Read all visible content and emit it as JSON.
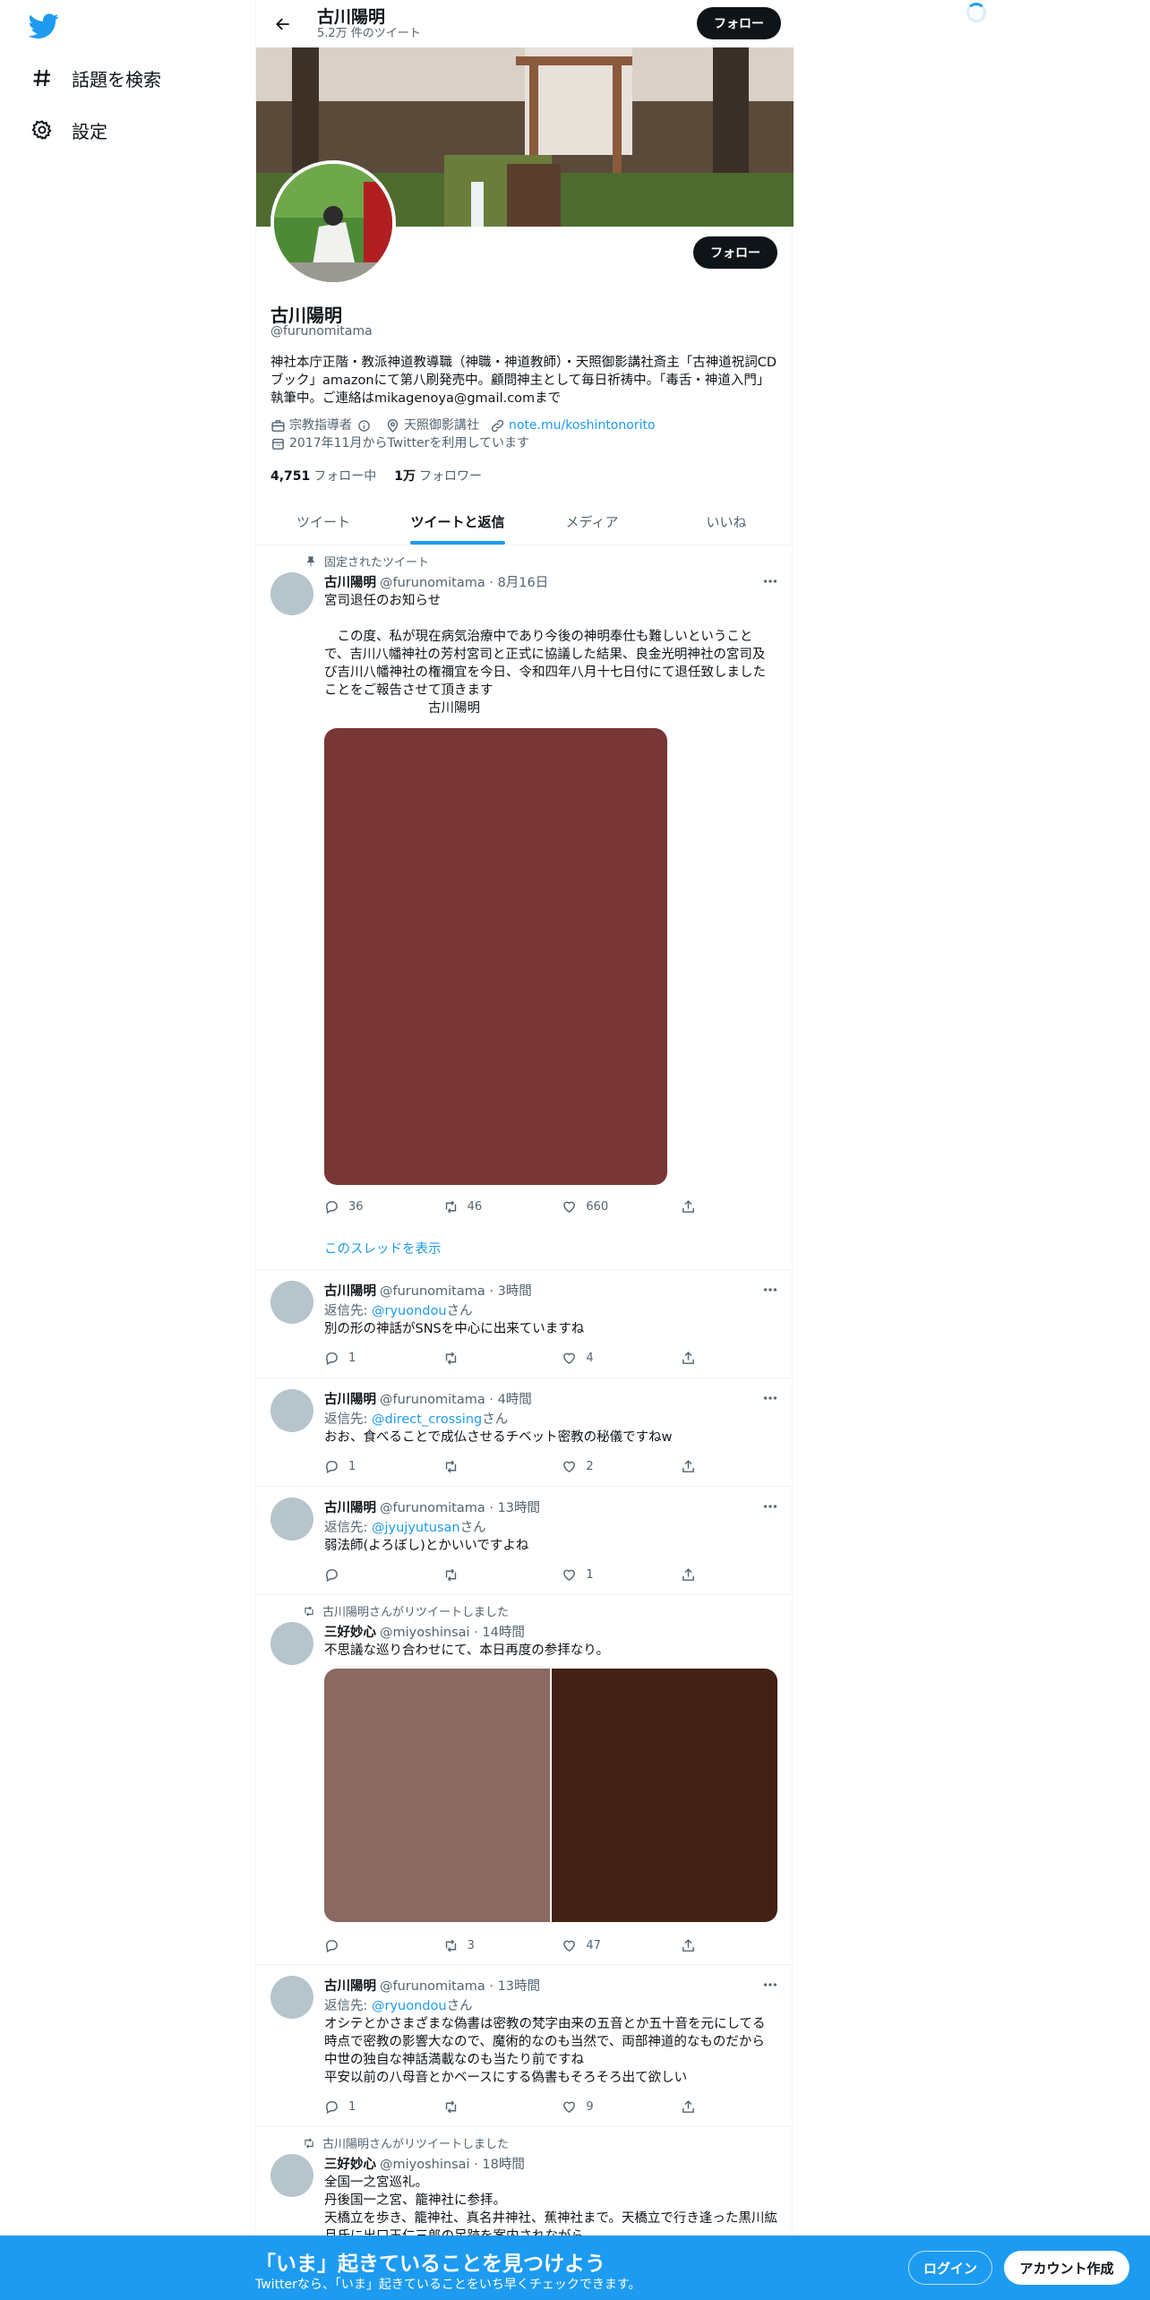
{
  "sidebar": {
    "items": [
      {
        "label": "話題を検索",
        "icon": "hashtag-icon"
      },
      {
        "label": "設定",
        "icon": "gear-icon"
      }
    ]
  },
  "header": {
    "name": "古川陽明",
    "tweet_count": "5.2万 件のツイート",
    "follow_label": "フォロー"
  },
  "profile": {
    "name": "古川陽明",
    "handle": "@furunomitama",
    "bio": "神社本庁正階・教派神道教導職（神職・神道教師）・天照御影講社斎主「古神道祝詞CDブック」amazonにて第八刷発売中。顧問神主として毎日祈祷中。「毒舌・神道入門」執筆中。ご連絡はmikagenoya@gmail.comまで",
    "category": "宗教指導者",
    "location": "天照御影講社",
    "website": "note.mu/koshintonorito",
    "joined": "2017年11月からTwitterを利用しています",
    "following_count": "4,751",
    "following_label": "フォロー中",
    "followers_count": "1万",
    "followers_label": "フォロワー",
    "follow_label": "フォロー"
  },
  "tabs": [
    {
      "label": "ツイート",
      "active": false
    },
    {
      "label": "ツイートと返信",
      "active": true
    },
    {
      "label": "メディア",
      "active": false
    },
    {
      "label": "いいね",
      "active": false
    }
  ],
  "tweets": [
    {
      "context": "固定されたツイート",
      "name": "古川陽明",
      "handle_time": "@furunomitama · 8月16日",
      "text": "宮司退任のお知らせ\n\n　この度、私が現在病気治療中であり今後の神明奉仕も難しいということで、吉川八幡神社の芳村宮司と正式に協議した結果、良金光明神社の宮司及び吉川八幡神社の権禰宜を今日、令和四年八月十七日付にて退任致しましたことをご報告させて頂きます\n　　　　　　　　古川陽明",
      "reply": "36",
      "retweet": "46",
      "like": "660",
      "thread_link": "このスレッドを表示",
      "media_color": "#783736"
    },
    {
      "name": "古川陽明",
      "handle_time": "@furunomitama · 3時間",
      "reply_prefix": "返信先: ",
      "reply_to": "@ryuondou",
      "reply_suffix": "さん",
      "text": "別の形の神話がSNSを中心に出来ていますね",
      "reply": "1",
      "retweet": "",
      "like": "4"
    },
    {
      "name": "古川陽明",
      "handle_time": "@furunomitama · 4時間",
      "reply_prefix": "返信先: ",
      "reply_to": "@direct_crossing",
      "reply_suffix": "さん",
      "text": "おお、食べることで成仏させるチベット密教の秘儀ですねw",
      "reply": "1",
      "retweet": "",
      "like": "2"
    },
    {
      "name": "古川陽明",
      "handle_time": "@furunomitama · 13時間",
      "reply_prefix": "返信先: ",
      "reply_to": "@jyujyutusan",
      "reply_suffix": "さん",
      "text": "弱法師(よろぼし)とかいいですよね",
      "reply": "",
      "retweet": "",
      "like": "1"
    },
    {
      "context": "古川陽明さんがリツイートしました",
      "name": "三好妙心",
      "handle_time": "@miyoshinsai · 14時間",
      "text": "不思議な巡り合わせにて、本日再度の参拝なり。",
      "reply": "",
      "retweet": "3",
      "like": "47",
      "media_colors": [
        "#8b6861",
        "#432114"
      ]
    },
    {
      "name": "古川陽明",
      "handle_time": "@furunomitama · 13時間",
      "reply_prefix": "返信先: ",
      "reply_to": "@ryuondou",
      "reply_suffix": "さん",
      "text": "オシテとかさまざまな偽書は密教の梵字由来の五音とか五十音を元にしてる時点で密教の影響大なので、魔術的なのも当然で、両部神道的なものだから中世の独自な神話満載なのも当たり前ですね\n平安以前の八母音とかベースにする偽書もそろそろ出て欲しい",
      "reply": "1",
      "retweet": "",
      "like": "9"
    },
    {
      "context": "古川陽明さんがリツイートしました",
      "name": "三好妙心",
      "handle_time": "@miyoshinsai · 18時間",
      "text": "全国一之宮巡礼。\n丹後国一之宮、籠神社に参拝。\n天橋立を歩き、籠神社、真名井神社、蕉神社まで。天橋立で行き逢った黒川紘月氏に出口王仁三郎の足跡を案内されながら"
    }
  ],
  "bottom_bar": {
    "title": "「いま」起きていることを見つけよう",
    "subtitle": "Twitterなら、「いま」起きていることをいち早くチェックできます。",
    "login": "ログイン",
    "signup": "アカウント作成"
  },
  "colors": {
    "accent": "#1d9bf0",
    "text": "#0f1419",
    "secondary": "#536471"
  }
}
